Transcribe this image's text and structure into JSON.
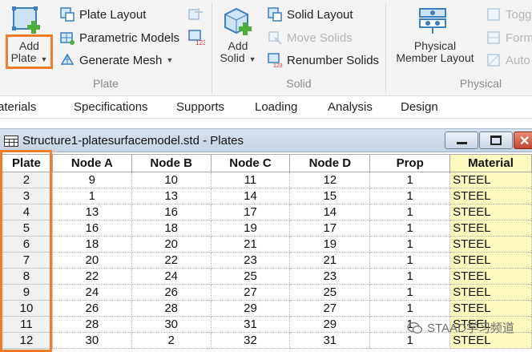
{
  "ribbon": {
    "plate_group": {
      "label": "Plate",
      "add_plate_line1": "Add",
      "add_plate_line2": "Plate",
      "plate_layout": "Plate Layout",
      "parametric_models": "Parametric Models",
      "generate_mesh": "Generate Mesh"
    },
    "solid_group": {
      "label": "Solid",
      "add_solid_line1": "Add",
      "add_solid_line2": "Solid",
      "solid_layout": "Solid Layout",
      "move_solids": "Move Solids",
      "renumber_solids": "Renumber Solids"
    },
    "physical_group": {
      "label": "Physical",
      "physical_member_layout_line1": "Physical",
      "physical_member_layout_line2": "Member Layout",
      "toggle": "Togg",
      "form": "Form",
      "auto": "Auto"
    }
  },
  "tabs": [
    "aterials",
    "Specifications",
    "Supports",
    "Loading",
    "Analysis",
    "Design"
  ],
  "window": {
    "title": "Structure1-platesurfacemodel.std - Plates"
  },
  "table": {
    "headers": [
      "Plate",
      "Node A",
      "Node B",
      "Node C",
      "Node D",
      "Prop",
      "Material"
    ],
    "rows": [
      [
        "2",
        "9",
        "10",
        "11",
        "12",
        "1",
        "STEEL"
      ],
      [
        "3",
        "1",
        "13",
        "14",
        "15",
        "1",
        "STEEL"
      ],
      [
        "4",
        "13",
        "16",
        "17",
        "14",
        "1",
        "STEEL"
      ],
      [
        "5",
        "16",
        "18",
        "19",
        "17",
        "1",
        "STEEL"
      ],
      [
        "6",
        "18",
        "20",
        "21",
        "19",
        "1",
        "STEEL"
      ],
      [
        "7",
        "20",
        "22",
        "23",
        "21",
        "1",
        "STEEL"
      ],
      [
        "8",
        "22",
        "24",
        "25",
        "23",
        "1",
        "STEEL"
      ],
      [
        "9",
        "24",
        "26",
        "27",
        "25",
        "1",
        "STEEL"
      ],
      [
        "10",
        "26",
        "28",
        "29",
        "27",
        "1",
        "STEEL"
      ],
      [
        "11",
        "28",
        "30",
        "31",
        "29",
        "1",
        "STEEL"
      ],
      [
        "12",
        "30",
        "2",
        "32",
        "31",
        "1",
        "STEEL"
      ]
    ]
  },
  "watermark": "STAAD学习频道",
  "colors": {
    "highlight": "#f07b2a",
    "material_cell": "#fbf9be",
    "icon_blue": "#3a7fc4",
    "icon_green": "#4caf3a"
  }
}
